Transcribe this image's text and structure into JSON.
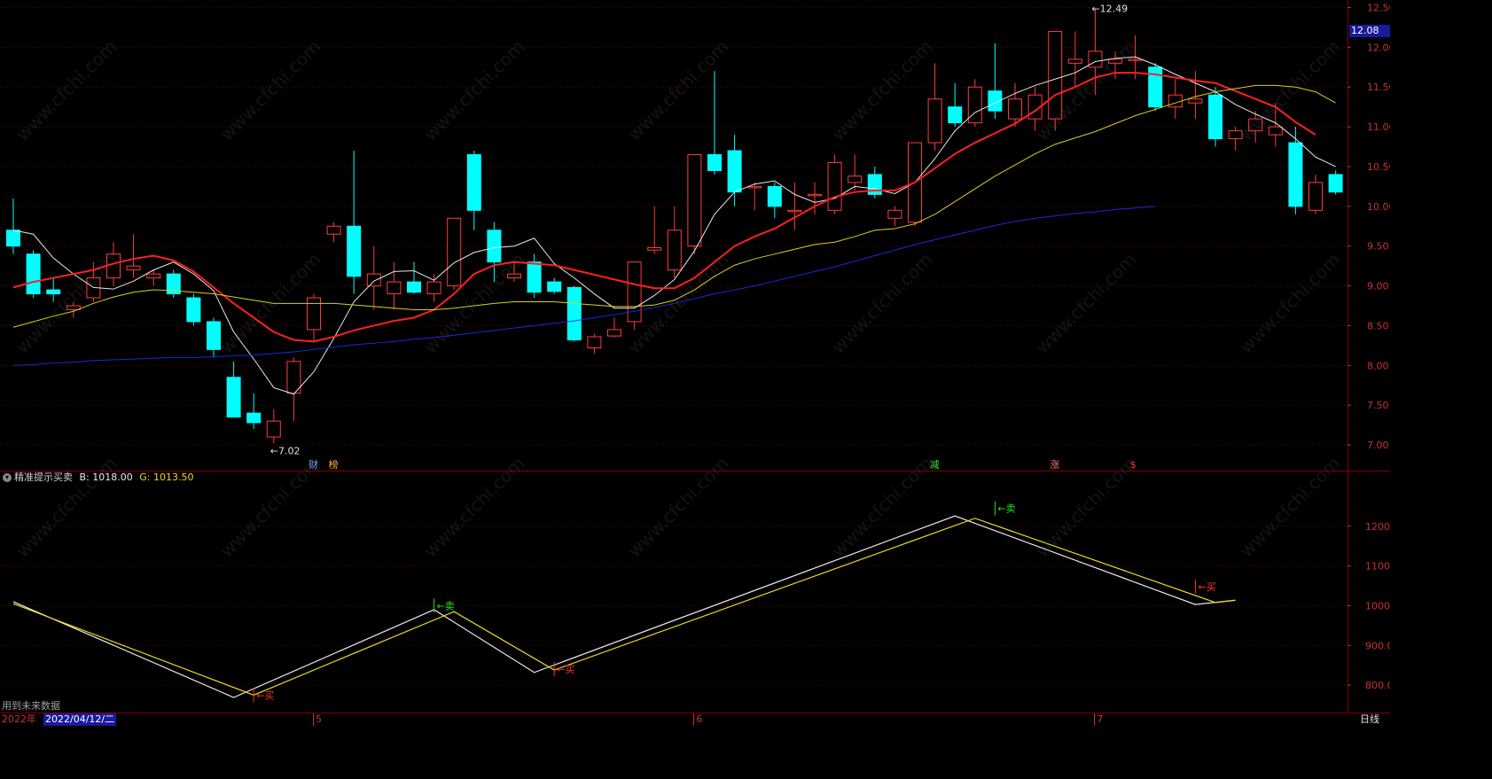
{
  "colors": {
    "background": "#000000",
    "grid": "#7a0000",
    "axis_text": "#c83232",
    "bull": "#ff3b3b",
    "bear": "#00ffff",
    "ma_white": "#e8e8e8",
    "ma_red": "#ff2020",
    "ma_yellow": "#d8d020",
    "ma_blue": "#1a2ad8",
    "ind_white": "#e8e8e8",
    "ind_yellow": "#e8d820",
    "buy": "#ff3030",
    "sell": "#20e020",
    "price_tag_bg": "#1a1a9a"
  },
  "watermark": "www.cfchi.com",
  "price_panel": {
    "last_price_tag": "12.08",
    "high_label": "12.49",
    "low_label": "7.02",
    "arrow": "←",
    "markers": [
      {
        "i": 15,
        "text": "财",
        "color": "#6aa8ff"
      },
      {
        "i": 16,
        "text": "榜",
        "color": "#ffb040"
      },
      {
        "i": 46,
        "text": "减",
        "color": "#30e030"
      },
      {
        "i": 52,
        "text": "涨",
        "color": "#ff7070"
      },
      {
        "i": 56,
        "text": "$",
        "color": "#ff3030"
      }
    ]
  },
  "indicator_panel": {
    "title": "精准提示买卖",
    "b_label": "B: 1018.00",
    "g_label": "G: 1013.50",
    "footer": "用到未来数据",
    "signal_prefix": "←",
    "buy_text": "买",
    "sell_text": "卖"
  },
  "date_axis": {
    "year_label": "2022年",
    "date_label": "2022/04/12/二",
    "month_labels": [
      {
        "i": 15,
        "text": "5"
      },
      {
        "i": 34,
        "text": "6"
      },
      {
        "i": 54,
        "text": "7"
      }
    ],
    "period_label": "日线"
  },
  "chart_data": [
    {
      "type": "candlestick",
      "title": "",
      "ylim": [
        6.8,
        12.55
      ],
      "y_ticks": [
        "12.50",
        "12.00",
        "11.50",
        "11.00",
        "10.50",
        "10.00",
        "9.50",
        "9.00",
        "8.50",
        "8.00",
        "7.50",
        "7.00"
      ],
      "candles": [
        {
          "o": 9.7,
          "h": 10.1,
          "l": 9.4,
          "c": 9.5
        },
        {
          "o": 9.4,
          "h": 9.45,
          "l": 8.85,
          "c": 8.9
        },
        {
          "o": 8.95,
          "h": 9.1,
          "l": 8.8,
          "c": 8.9
        },
        {
          "o": 8.7,
          "h": 8.8,
          "l": 8.6,
          "c": 8.75
        },
        {
          "o": 8.85,
          "h": 9.3,
          "l": 8.8,
          "c": 9.1
        },
        {
          "o": 9.1,
          "h": 9.55,
          "l": 9.0,
          "c": 9.4
        },
        {
          "o": 9.2,
          "h": 9.65,
          "l": 9.1,
          "c": 9.25
        },
        {
          "o": 9.1,
          "h": 9.2,
          "l": 9.0,
          "c": 9.15
        },
        {
          "o": 9.15,
          "h": 9.2,
          "l": 8.85,
          "c": 8.9
        },
        {
          "o": 8.85,
          "h": 8.9,
          "l": 8.5,
          "c": 8.55
        },
        {
          "o": 8.55,
          "h": 8.6,
          "l": 8.1,
          "c": 8.2
        },
        {
          "o": 7.85,
          "h": 8.05,
          "l": 7.35,
          "c": 7.35
        },
        {
          "o": 7.4,
          "h": 7.65,
          "l": 7.2,
          "c": 7.28
        },
        {
          "o": 7.1,
          "h": 7.45,
          "l": 7.02,
          "c": 7.3
        },
        {
          "o": 7.65,
          "h": 8.1,
          "l": 7.3,
          "c": 8.05
        },
        {
          "o": 8.45,
          "h": 8.9,
          "l": 8.3,
          "c": 8.85
        },
        {
          "o": 9.65,
          "h": 9.8,
          "l": 9.55,
          "c": 9.75
        },
        {
          "o": 9.75,
          "h": 10.7,
          "l": 8.9,
          "c": 9.12
        },
        {
          "o": 9.0,
          "h": 9.5,
          "l": 8.7,
          "c": 9.15
        },
        {
          "o": 8.9,
          "h": 9.3,
          "l": 8.7,
          "c": 9.05
        },
        {
          "o": 9.05,
          "h": 9.3,
          "l": 8.9,
          "c": 8.92
        },
        {
          "o": 8.9,
          "h": 9.15,
          "l": 8.8,
          "c": 9.05
        },
        {
          "o": 9.0,
          "h": 9.85,
          "l": 8.95,
          "c": 9.85
        },
        {
          "o": 10.65,
          "h": 10.7,
          "l": 9.7,
          "c": 9.95
        },
        {
          "o": 9.7,
          "h": 9.8,
          "l": 9.05,
          "c": 9.3
        },
        {
          "o": 9.1,
          "h": 9.3,
          "l": 9.05,
          "c": 9.15
        },
        {
          "o": 9.3,
          "h": 9.4,
          "l": 8.85,
          "c": 8.92
        },
        {
          "o": 9.05,
          "h": 9.1,
          "l": 8.9,
          "c": 8.93
        },
        {
          "o": 8.98,
          "h": 9.0,
          "l": 8.3,
          "c": 8.32
        },
        {
          "o": 8.22,
          "h": 8.4,
          "l": 8.15,
          "c": 8.36
        },
        {
          "o": 8.37,
          "h": 8.6,
          "l": 8.35,
          "c": 8.45
        },
        {
          "o": 8.55,
          "h": 9.3,
          "l": 8.45,
          "c": 9.3
        },
        {
          "o": 9.45,
          "h": 10.0,
          "l": 9.4,
          "c": 9.48
        },
        {
          "o": 9.2,
          "h": 10.0,
          "l": 9.1,
          "c": 9.7
        },
        {
          "o": 9.5,
          "h": 10.65,
          "l": 9.4,
          "c": 10.65
        },
        {
          "o": 10.65,
          "h": 11.7,
          "l": 10.4,
          "c": 10.45
        },
        {
          "o": 10.7,
          "h": 10.9,
          "l": 10.0,
          "c": 10.18
        },
        {
          "o": 10.25,
          "h": 10.3,
          "l": 9.95,
          "c": 10.25
        },
        {
          "o": 10.25,
          "h": 10.3,
          "l": 9.85,
          "c": 10.0
        },
        {
          "o": 9.95,
          "h": 10.3,
          "l": 9.7,
          "c": 9.95
        },
        {
          "o": 10.15,
          "h": 10.3,
          "l": 9.9,
          "c": 10.15
        },
        {
          "o": 9.95,
          "h": 10.65,
          "l": 9.9,
          "c": 10.55
        },
        {
          "o": 10.3,
          "h": 10.65,
          "l": 10.2,
          "c": 10.38
        },
        {
          "o": 10.4,
          "h": 10.5,
          "l": 10.1,
          "c": 10.15
        },
        {
          "o": 9.85,
          "h": 10.0,
          "l": 9.75,
          "c": 9.95
        },
        {
          "o": 9.8,
          "h": 10.8,
          "l": 9.75,
          "c": 10.8
        },
        {
          "o": 10.8,
          "h": 11.8,
          "l": 10.7,
          "c": 11.35
        },
        {
          "o": 11.25,
          "h": 11.55,
          "l": 11.0,
          "c": 11.05
        },
        {
          "o": 11.05,
          "h": 11.6,
          "l": 11.0,
          "c": 11.5
        },
        {
          "o": 11.45,
          "h": 12.05,
          "l": 11.1,
          "c": 11.2
        },
        {
          "o": 11.1,
          "h": 11.55,
          "l": 11.0,
          "c": 11.35
        },
        {
          "o": 11.1,
          "h": 11.5,
          "l": 10.95,
          "c": 11.4
        },
        {
          "o": 11.1,
          "h": 11.8,
          "l": 10.95,
          "c": 12.2
        },
        {
          "o": 11.8,
          "h": 12.2,
          "l": 11.5,
          "c": 11.85
        },
        {
          "o": 11.75,
          "h": 12.49,
          "l": 11.4,
          "c": 11.95
        },
        {
          "o": 11.8,
          "h": 11.95,
          "l": 11.6,
          "c": 11.85
        },
        {
          "o": 11.85,
          "h": 12.15,
          "l": 11.6,
          "c": 11.85
        },
        {
          "o": 11.75,
          "h": 11.8,
          "l": 11.2,
          "c": 11.25
        },
        {
          "o": 11.25,
          "h": 11.6,
          "l": 11.1,
          "c": 11.4
        },
        {
          "o": 11.3,
          "h": 11.7,
          "l": 11.1,
          "c": 11.35
        },
        {
          "o": 11.4,
          "h": 11.5,
          "l": 10.75,
          "c": 10.85
        },
        {
          "o": 10.85,
          "h": 11.0,
          "l": 10.7,
          "c": 10.95
        },
        {
          "o": 10.95,
          "h": 11.2,
          "l": 10.8,
          "c": 11.1
        },
        {
          "o": 10.9,
          "h": 11.3,
          "l": 10.75,
          "c": 11.0
        },
        {
          "o": 10.8,
          "h": 11.0,
          "l": 9.9,
          "c": 10.0
        },
        {
          "o": 9.95,
          "h": 10.4,
          "l": 9.9,
          "c": 10.3
        },
        {
          "o": 10.4,
          "h": 10.45,
          "l": 10.15,
          "c": 10.18
        }
      ],
      "series": [
        {
          "name": "",
          "color_key": "ma_white",
          "values": [
            9.7,
            9.65,
            9.35,
            9.15,
            8.98,
            8.96,
            9.06,
            9.2,
            9.3,
            9.15,
            8.94,
            8.42,
            8.08,
            7.72,
            7.64,
            7.92,
            8.34,
            8.8,
            9.06,
            9.18,
            9.19,
            9.07,
            9.29,
            9.42,
            9.48,
            9.5,
            9.6,
            9.28,
            9.1,
            8.9,
            8.72,
            8.72,
            8.88,
            9.08,
            9.44,
            9.9,
            10.18,
            10.28,
            10.32,
            10.15,
            10.05,
            10.1,
            10.25,
            10.22,
            10.16,
            10.3,
            10.6,
            10.95,
            11.18,
            11.3,
            11.42,
            11.52,
            11.6,
            11.68,
            11.82,
            11.86,
            11.88,
            11.78,
            11.66,
            11.55,
            11.44,
            11.28,
            11.16,
            11.05,
            10.85,
            10.62,
            10.5
          ]
        },
        {
          "name": "",
          "color_key": "ma_red",
          "values": [
            8.98,
            9.05,
            9.1,
            9.15,
            9.2,
            9.28,
            9.34,
            9.38,
            9.32,
            9.18,
            8.98,
            8.78,
            8.6,
            8.42,
            8.32,
            8.3,
            8.36,
            8.44,
            8.5,
            8.56,
            8.6,
            8.7,
            8.9,
            9.15,
            9.26,
            9.3,
            9.28,
            9.26,
            9.2,
            9.14,
            9.08,
            9.02,
            8.97,
            8.97,
            9.1,
            9.3,
            9.5,
            9.62,
            9.72,
            9.86,
            10.0,
            10.12,
            10.18,
            10.2,
            10.2,
            10.3,
            10.48,
            10.66,
            10.8,
            10.92,
            11.04,
            11.2,
            11.4,
            11.5,
            11.62,
            11.68,
            11.68,
            11.66,
            11.62,
            11.58,
            11.55,
            11.45,
            11.35,
            11.25,
            11.06,
            10.9
          ]
        },
        {
          "name": "",
          "color_key": "ma_yellow",
          "values": [
            8.48,
            8.55,
            8.62,
            8.68,
            8.78,
            8.86,
            8.92,
            8.95,
            8.94,
            8.92,
            8.9,
            8.86,
            8.82,
            8.78,
            8.78,
            8.78,
            8.78,
            8.76,
            8.74,
            8.72,
            8.7,
            8.7,
            8.72,
            8.75,
            8.78,
            8.8,
            8.8,
            8.8,
            8.78,
            8.76,
            8.74,
            8.74,
            8.76,
            8.82,
            8.95,
            9.12,
            9.26,
            9.34,
            9.4,
            9.46,
            9.52,
            9.55,
            9.62,
            9.7,
            9.72,
            9.78,
            9.9,
            10.06,
            10.22,
            10.38,
            10.52,
            10.66,
            10.78,
            10.86,
            10.94,
            11.04,
            11.14,
            11.22,
            11.3,
            11.38,
            11.44,
            11.48,
            11.52,
            11.52,
            11.5,
            11.44,
            11.3
          ]
        },
        {
          "name": "",
          "color_key": "ma_blue",
          "values": [
            8.0,
            8.01,
            8.03,
            8.04,
            8.06,
            8.07,
            8.08,
            8.09,
            8.1,
            8.1,
            8.11,
            8.12,
            8.13,
            8.15,
            8.17,
            8.2,
            8.23,
            8.26,
            8.28,
            8.3,
            8.33,
            8.35,
            8.38,
            8.41,
            8.44,
            8.47,
            8.5,
            8.53,
            8.56,
            8.6,
            8.64,
            8.68,
            8.73,
            8.78,
            8.84,
            8.9,
            8.95,
            9.0,
            9.06,
            9.12,
            9.18,
            9.24,
            9.31,
            9.38,
            9.45,
            9.52,
            9.58,
            9.64,
            9.7,
            9.76,
            9.81,
            9.85,
            9.88,
            9.91,
            9.93,
            9.96,
            9.98,
            10.0
          ]
        }
      ]
    },
    {
      "type": "line",
      "title": "",
      "ylim": [
        740,
        1320
      ],
      "y_ticks": [
        "1200",
        "1100",
        "1000",
        "900.0",
        "800.0"
      ],
      "series": [
        {
          "name": "B",
          "color_key": "ind_white",
          "points": [
            [
              0,
              1010
            ],
            [
              11,
              769
            ],
            [
              21,
              990
            ],
            [
              26,
              832
            ],
            [
              47,
              1226
            ],
            [
              59,
              1003
            ],
            [
              61,
              1014
            ]
          ]
        },
        {
          "name": "G",
          "color_key": "ind_yellow",
          "points": [
            [
              0,
              1005
            ],
            [
              12,
              775
            ],
            [
              22,
              985
            ],
            [
              27,
              838
            ],
            [
              48,
              1220
            ],
            [
              60,
              1008
            ],
            [
              61,
              1013.5
            ]
          ]
        }
      ],
      "signals": [
        {
          "type": "buy",
          "i": 12,
          "v": 775
        },
        {
          "type": "sell",
          "i": 21,
          "v": 1000
        },
        {
          "type": "buy",
          "i": 27,
          "v": 840
        },
        {
          "type": "sell",
          "i": 49,
          "v": 1245
        },
        {
          "type": "buy",
          "i": 59,
          "v": 1048
        }
      ]
    }
  ]
}
